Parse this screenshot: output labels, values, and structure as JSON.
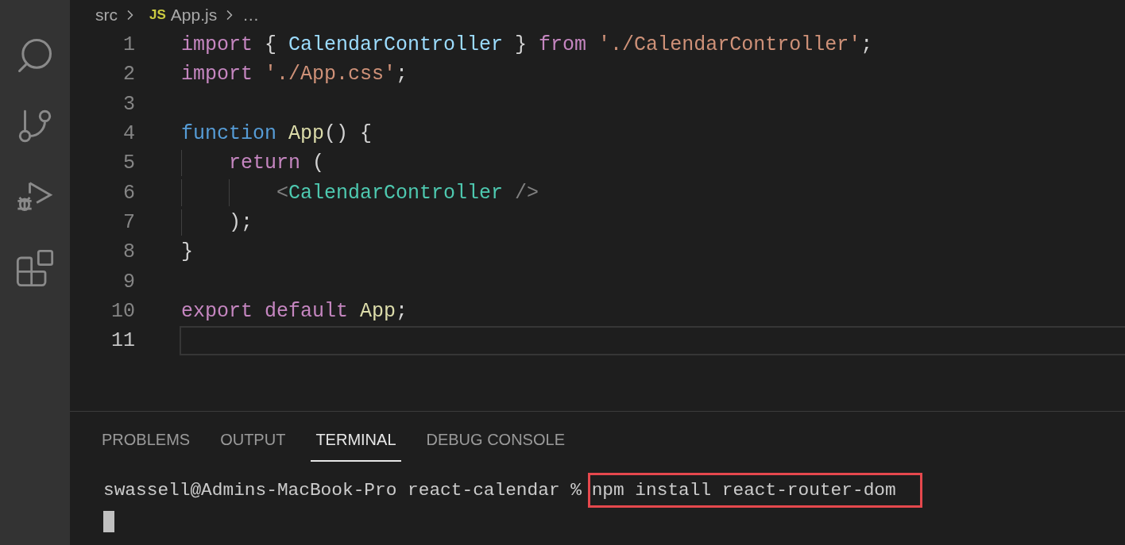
{
  "breadcrumbs": {
    "folder": "src",
    "file_badge": "JS",
    "file": "App.js",
    "more": "…"
  },
  "editor": {
    "lines": [
      {
        "number": "1",
        "current": false,
        "tokens": [
          {
            "kind": "keyword",
            "text": "import"
          },
          {
            "kind": "punct",
            "text": " { "
          },
          {
            "kind": "variable",
            "text": "CalendarController"
          },
          {
            "kind": "punct",
            "text": " } "
          },
          {
            "kind": "keyword",
            "text": "from"
          },
          {
            "kind": "string",
            "text": " './CalendarController'"
          },
          {
            "kind": "punct",
            "text": ";"
          }
        ]
      },
      {
        "number": "2",
        "current": false,
        "tokens": [
          {
            "kind": "keyword",
            "text": "import"
          },
          {
            "kind": "string",
            "text": " './App.css'"
          },
          {
            "kind": "punct",
            "text": ";"
          }
        ]
      },
      {
        "number": "3",
        "current": false
      },
      {
        "number": "4",
        "current": false,
        "tokens": [
          {
            "kind": "storage",
            "text": "function"
          },
          {
            "kind": "function",
            "text": " App"
          },
          {
            "kind": "punct",
            "text": "() {"
          }
        ]
      },
      {
        "number": "5",
        "current": false,
        "tokens": [
          {
            "kind": "keyword",
            "text": "    return"
          },
          {
            "kind": "punct",
            "text": " ("
          }
        ]
      },
      {
        "number": "6",
        "current": false,
        "tokens": [
          {
            "kind": "bracket",
            "text": "        <"
          },
          {
            "kind": "tag",
            "text": "CalendarController"
          },
          {
            "kind": "bracket",
            "text": " />"
          }
        ]
      },
      {
        "number": "7",
        "current": false,
        "tokens": [
          {
            "kind": "punct",
            "text": "    );"
          }
        ]
      },
      {
        "number": "8",
        "current": false,
        "tokens": [
          {
            "kind": "punct",
            "text": "}"
          }
        ]
      },
      {
        "number": "9",
        "current": false
      },
      {
        "number": "10",
        "current": false,
        "tokens": [
          {
            "kind": "keyword",
            "text": "export"
          },
          {
            "kind": "keyword",
            "text": " default"
          },
          {
            "kind": "function",
            "text": " App"
          },
          {
            "kind": "punct",
            "text": ";"
          }
        ]
      },
      {
        "number": "11",
        "current": true
      }
    ]
  },
  "panel": {
    "tabs": [
      {
        "label": "PROBLEMS",
        "selected": false
      },
      {
        "label": "OUTPUT",
        "selected": false
      },
      {
        "label": "TERMINAL",
        "selected": true
      },
      {
        "label": "DEBUG CONSOLE",
        "selected": false
      }
    ],
    "terminal": {
      "prompt": "swassell@Admins-MacBook-Pro react-calendar % ",
      "command": "npm install react-router-dom",
      "highlighted": true
    }
  }
}
